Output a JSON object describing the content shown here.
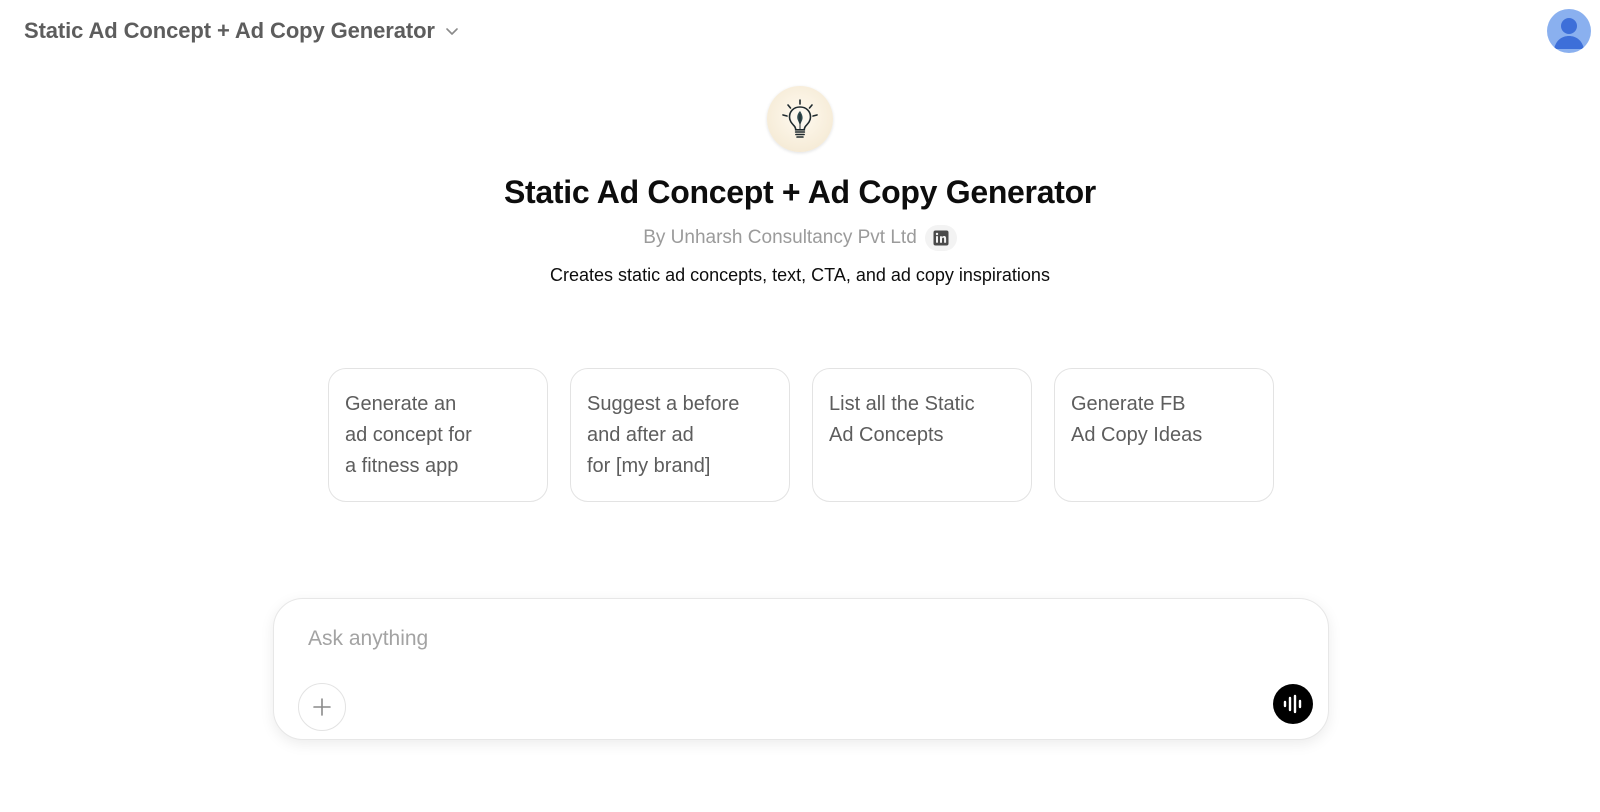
{
  "header": {
    "model_title": "Static Ad Concept + Ad Copy Generator",
    "chevron_icon": "chevron-down-icon",
    "avatar_icon": "user-avatar-icon"
  },
  "gpt": {
    "logo_icon": "lightbulb-icon",
    "title": "Static Ad Concept + Ad Copy Generator",
    "byline": "By Unharsh Consultancy Pvt Ltd",
    "social_icon": "linkedin-icon",
    "description": "Creates static ad concepts, text, CTA, and ad copy inspirations"
  },
  "starters": [
    {
      "text": "Generate an\nad concept for\na fitness app"
    },
    {
      "text": "Suggest a before\nand after ad\nfor [my brand]"
    },
    {
      "text": "List all the Static\nAd Concepts"
    },
    {
      "text": "Generate FB\nAd Copy Ideas"
    }
  ],
  "composer": {
    "placeholder": "Ask anything",
    "value": "",
    "attach_icon": "plus-icon",
    "voice_icon": "voice-mode-icon"
  },
  "colors": {
    "avatar_bg": "#8ab0ef",
    "avatar_fg": "#3d6fd9",
    "voice_button_bg": "#000000",
    "muted_text": "#9b9b9b"
  }
}
